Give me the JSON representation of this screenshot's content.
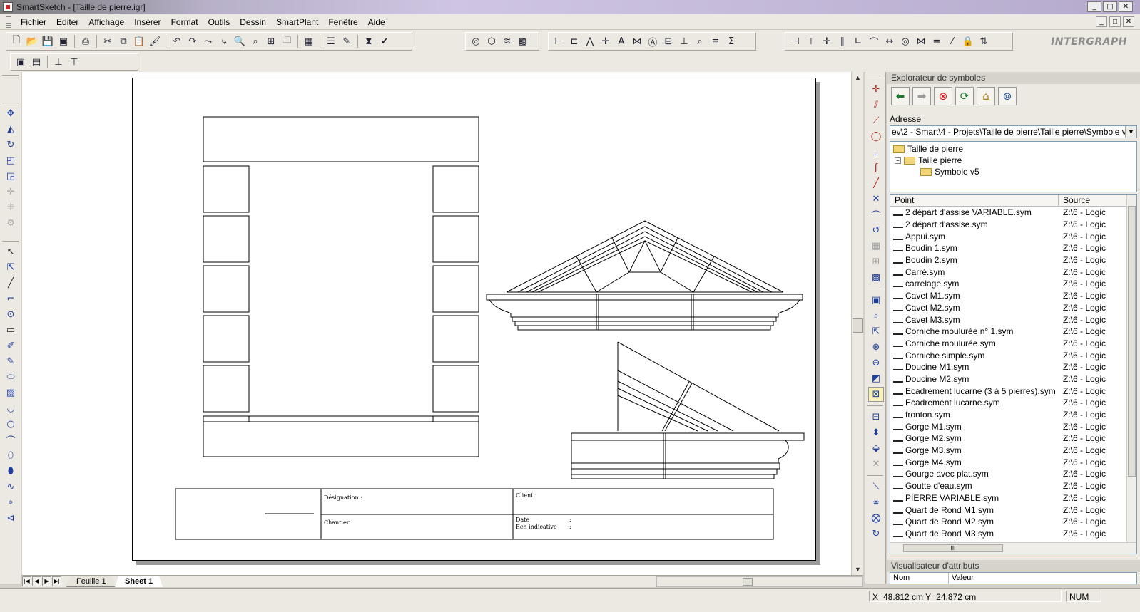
{
  "window": {
    "title": "SmartSketch  - [Taille de pierre.igr]",
    "controls": [
      "_",
      "□",
      "✕"
    ]
  },
  "menubar": {
    "items": [
      "Fichier",
      "Editer",
      "Affichage",
      "Insérer",
      "Format",
      "Outils",
      "Dessin",
      "SmartPlant",
      "Fenêtre",
      "Aide"
    ],
    "mdi_controls": [
      "_",
      "□",
      "✕"
    ]
  },
  "toolbar": {
    "logo": "INTERGRAPH"
  },
  "titleblock": {
    "designation": "Désignation :",
    "client": "Client :",
    "chantier": "Chantier :",
    "date": "Date",
    "date_sep": ":",
    "ech": "Ech indicative",
    "ech_sep": ":"
  },
  "tabs": {
    "inactive": "Feuille 1",
    "active": "Sheet 1"
  },
  "symbol_explorer": {
    "title": "Explorateur de symboles",
    "address_label": "Adresse",
    "address": "ev\\2 - Smart\\4 - Projets\\Taille de pierre\\Taille pierre\\Symbole v5",
    "tree": [
      "Taille de pierre",
      "Taille pierre",
      "Symbole v5"
    ],
    "tree_expander": "−",
    "columns": [
      "Point",
      "Source"
    ],
    "scroll_grip": "III",
    "files": [
      "2 départ d'assise VARIABLE.sym",
      "2 départ d'assise.sym",
      "Appui.sym",
      "Boudin 1.sym",
      "Boudin 2.sym",
      "Carré.sym",
      "carrelage.sym",
      "Cavet M1.sym",
      "Cavet M2.sym",
      "Cavet M3.sym",
      "Corniche moulurée n° 1.sym",
      "Corniche moulurée.sym",
      "Corniche simple.sym",
      "Doucine M1.sym",
      "Doucine M2.sym",
      "Ecadrement lucarne  (3 à 5 pierres).sym",
      "Ecadrement lucarne.sym",
      "fronton.sym",
      "Gorge M1.sym",
      "Gorge M2.sym",
      "Gorge M3.sym",
      "Gorge M4.sym",
      "Gourge avec plat.sym",
      "Goutte d'eau.sym",
      "PIERRE VARIABLE.sym",
      "Quart de Rond M1.sym",
      "Quart de Rond M2.sym",
      "Quart de Rond M3.sym"
    ],
    "source_value": "Z:\\6 - Logic"
  },
  "attribute_viewer": {
    "title": "Visualisateur d'attributs",
    "columns": [
      "Nom",
      "Valeur"
    ]
  },
  "status": {
    "coords": "X=48.812 cm   Y=24.872 cm",
    "num": "NUM"
  }
}
